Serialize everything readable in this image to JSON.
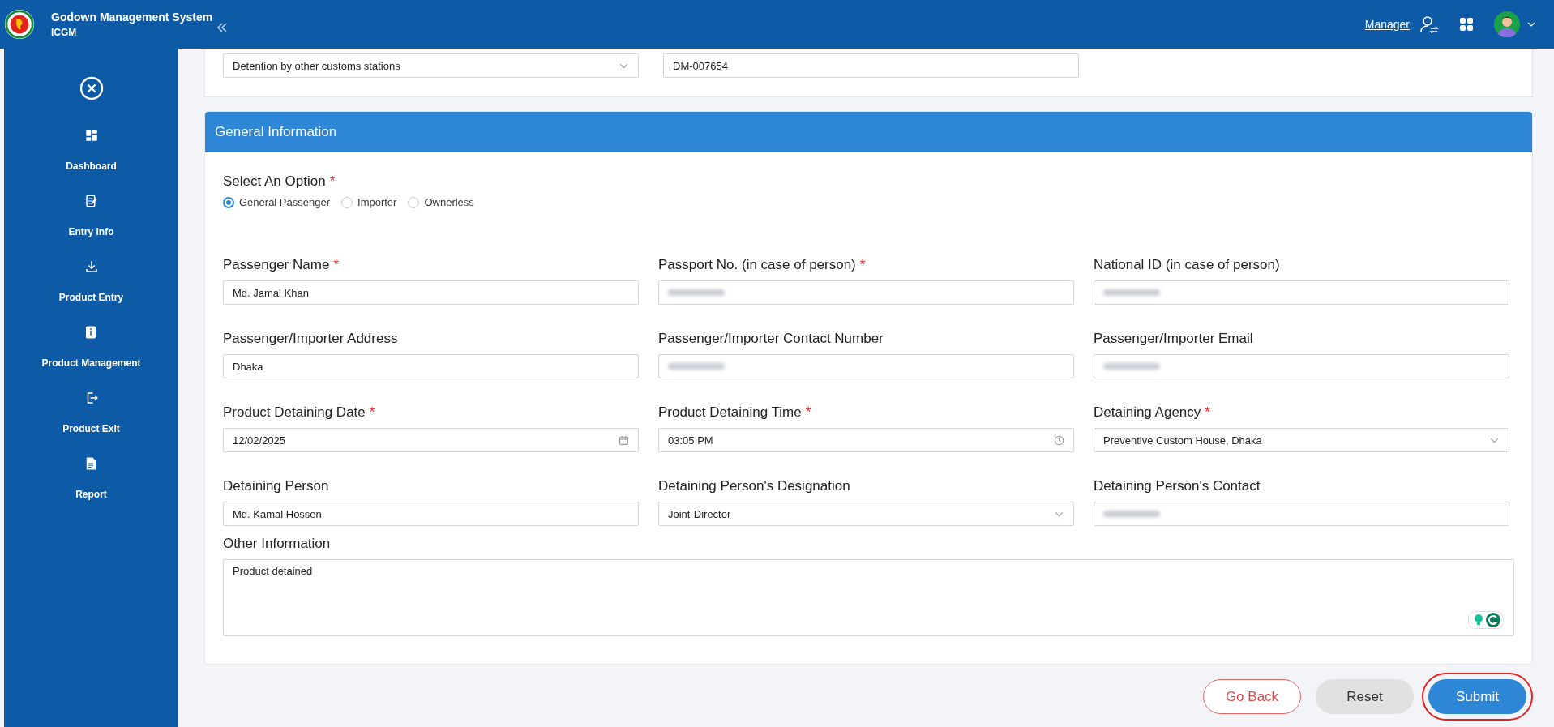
{
  "header": {
    "title": "Godown Management System",
    "subtitle": "ICGM",
    "role_link": "Manager"
  },
  "sidebar": {
    "items": [
      {
        "label": "Dashboard"
      },
      {
        "label": "Entry Info"
      },
      {
        "label": "Product Entry"
      },
      {
        "label": "Product Management"
      },
      {
        "label": "Product Exit"
      },
      {
        "label": "Report"
      }
    ]
  },
  "top_section": {
    "fields": [
      {
        "kind": "select",
        "value": "Detention by other customs stations"
      },
      {
        "kind": "text",
        "value": "DM-007654"
      }
    ]
  },
  "general_information": {
    "title": "General Information",
    "option_label": "Select An Option",
    "option_required_mark": "*",
    "options": [
      {
        "label": "General Passenger",
        "selected": true
      },
      {
        "label": "Importer",
        "selected": false
      },
      {
        "label": "Ownerless",
        "selected": false
      }
    ],
    "fields": [
      {
        "label": "Passenger Name",
        "required_mark": "*",
        "kind": "text",
        "value": "Md. Jamal Khan"
      },
      {
        "label": "Passport No. (in case of person)",
        "required_mark": "*",
        "kind": "blurred"
      },
      {
        "label": "National ID (in case of person)",
        "kind": "blurred"
      },
      {
        "label": "Passenger/Importer Address",
        "kind": "text",
        "value": "Dhaka"
      },
      {
        "label": "Passenger/Importer Contact Number",
        "kind": "blurred"
      },
      {
        "label": "Passenger/Importer Email",
        "kind": "blurred"
      },
      {
        "label": "Product Detaining Date",
        "required_mark": "*",
        "kind": "date",
        "value": "12/02/2025"
      },
      {
        "label": "Product Detaining Time",
        "required_mark": "*",
        "kind": "time",
        "value": "03:05 PM"
      },
      {
        "label": "Detaining Agency",
        "required_mark": "*",
        "kind": "select",
        "value": "Preventive Custom House, Dhaka"
      },
      {
        "label": "Detaining Person",
        "kind": "text",
        "value": "Md. Kamal Hossen"
      },
      {
        "label": "Detaining Person's Designation",
        "kind": "select",
        "value": "Joint-Director"
      },
      {
        "label": "Detaining Person's Contact",
        "kind": "blurred"
      }
    ],
    "other_information": {
      "label": "Other Information",
      "value": "Product detained"
    }
  },
  "buttons": [
    {
      "label": "Go Back",
      "kind": "outline",
      "highlighted": false
    },
    {
      "label": "Reset",
      "kind": "secondary",
      "highlighted": false
    },
    {
      "label": "Submit",
      "kind": "primary",
      "highlighted": true
    }
  ]
}
